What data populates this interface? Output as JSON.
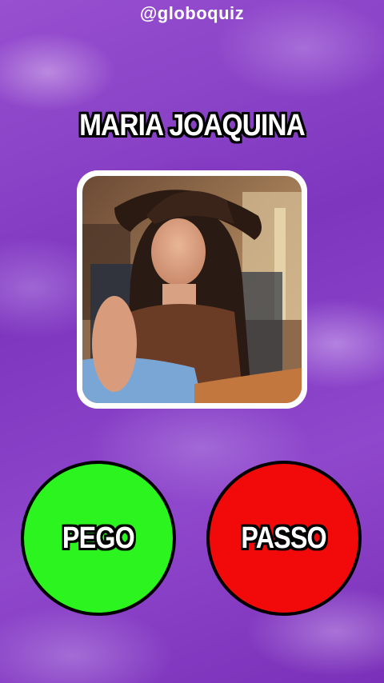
{
  "header": {
    "handle": "@globoquiz"
  },
  "card": {
    "title": "MARIA JOAQUINA",
    "photo_subject": "woman in cowboy hat seated in chair"
  },
  "choices": {
    "accept_label": "PEGO",
    "reject_label": "PASSO"
  },
  "colors": {
    "background": "#8a3fc4",
    "accept": "#2bf41e",
    "reject": "#f20a0a"
  }
}
